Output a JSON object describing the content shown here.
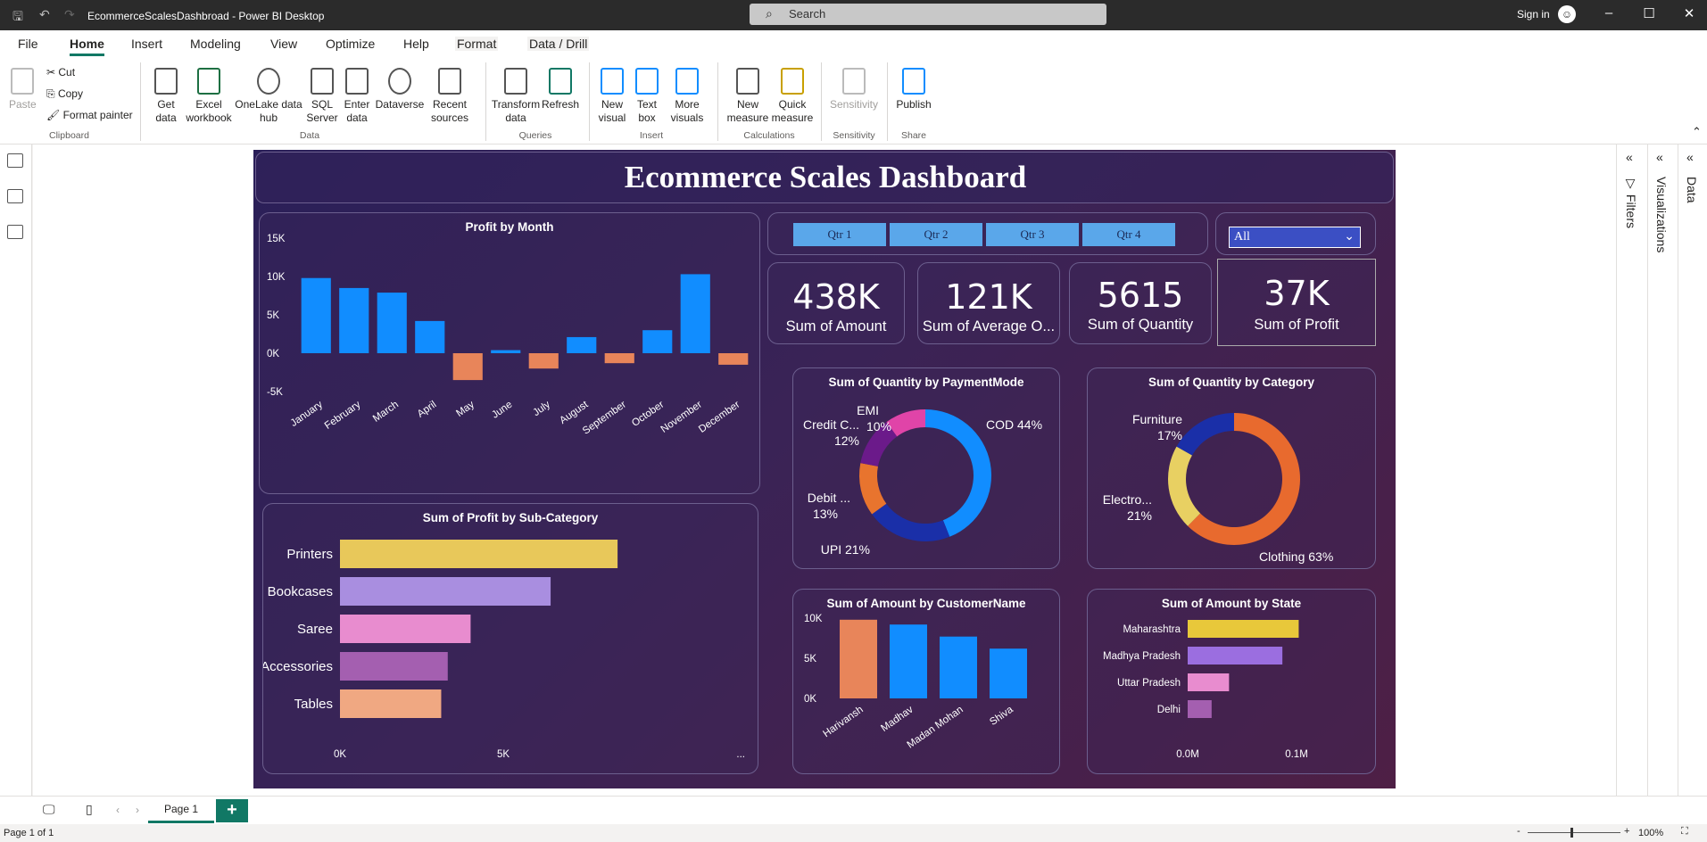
{
  "app": {
    "title": "EcommerceScalesDashbroad - Power BI Desktop",
    "search_placeholder": "Search",
    "signin": "Sign in"
  },
  "menu": [
    "File",
    "Home",
    "Insert",
    "Modeling",
    "View",
    "Optimize",
    "Help",
    "Format",
    "Data / Drill"
  ],
  "ribbon": {
    "clipboard": {
      "paste": "Paste",
      "cut": "Cut",
      "copy": "Copy",
      "format_painter": "Format painter",
      "group": "Clipboard"
    },
    "data": {
      "items": [
        "Get data",
        "Excel workbook",
        "OneLake data hub",
        "SQL Server",
        "Enter data",
        "Dataverse",
        "Recent sources"
      ],
      "group": "Data"
    },
    "queries": {
      "items": [
        "Transform data",
        "Refresh"
      ],
      "group": "Queries"
    },
    "insert": {
      "items": [
        "New visual",
        "Text box",
        "More visuals"
      ],
      "group": "Insert"
    },
    "calculations": {
      "items": [
        "New measure",
        "Quick measure"
      ],
      "group": "Calculations"
    },
    "sensitivity": {
      "items": [
        "Sensitivity"
      ],
      "group": "Sensitivity"
    },
    "share": {
      "items": [
        "Publish"
      ],
      "group": "Share"
    }
  },
  "dashboard": {
    "title": "Ecommerce Scales Dashboard",
    "quarters": [
      "Qtr 1",
      "Qtr 2",
      "Qtr 3",
      "Qtr 4"
    ],
    "slicer_value": "All",
    "cards": [
      {
        "value": "438K",
        "label": "Sum of Amount"
      },
      {
        "value": "121K",
        "label": "Sum of Average O..."
      },
      {
        "value": "5615",
        "label": "Sum of Quantity"
      },
      {
        "value": "37K",
        "label": "Sum of Profit"
      }
    ]
  },
  "chart_data": [
    {
      "type": "bar",
      "title": "Profit by Month",
      "categories": [
        "January",
        "February",
        "March",
        "April",
        "May",
        "June",
        "July",
        "August",
        "September",
        "October",
        "November",
        "December"
      ],
      "values": [
        9800,
        8500,
        7900,
        4200,
        -3500,
        400,
        -2000,
        2100,
        -1300,
        3000,
        10300,
        -1500
      ],
      "ylim": [
        -5000,
        15000
      ],
      "yticks": [
        "-5K",
        "0K",
        "5K",
        "10K",
        "15K"
      ],
      "colors": {
        "positive": "#118dff",
        "negative": "#e8855a"
      }
    },
    {
      "type": "bar",
      "orientation": "horizontal",
      "title": "Sum of Profit by Sub-Category",
      "categories": [
        "Printers",
        "Bookcases",
        "Saree",
        "Accessories",
        "Tables"
      ],
      "values": [
        8500,
        6450,
        4000,
        3300,
        3100
      ],
      "xticks": [
        "0K",
        "5K",
        "..."
      ],
      "colors": [
        "#e8c85a",
        "#a98ee0",
        "#e88ccf",
        "#a45fb0",
        "#f0a882"
      ]
    },
    {
      "type": "pie",
      "title": "Sum of Quantity by PaymentMode",
      "slices": [
        {
          "label": "COD",
          "value": 44,
          "color": "#118dff"
        },
        {
          "label": "UPI",
          "value": 21,
          "color": "#1a2fa8"
        },
        {
          "label": "Debit ...",
          "value": 13,
          "color": "#e8742e"
        },
        {
          "label": "Credit C...",
          "value": 12,
          "color": "#6b1a8a"
        },
        {
          "label": "EMI",
          "value": 10,
          "color": "#e044a8"
        }
      ]
    },
    {
      "type": "pie",
      "title": "Sum of Quantity by Category",
      "slices": [
        {
          "label": "Clothing",
          "value": 63,
          "color": "#e86a2e"
        },
        {
          "label": "Electro...",
          "value": 21,
          "color": "#e8d062"
        },
        {
          "label": "Furniture",
          "value": 17,
          "color": "#1a2fa8"
        }
      ]
    },
    {
      "type": "bar",
      "title": "Sum of Amount by CustomerName",
      "categories": [
        "Harivansh",
        "Madhav",
        "Madan Mohan",
        "Shiva"
      ],
      "values": [
        9800,
        9200,
        7700,
        6200
      ],
      "yticks": [
        "0K",
        "5K",
        "10K"
      ],
      "colors": [
        "#e8855a",
        "#118dff",
        "#118dff",
        "#118dff"
      ]
    },
    {
      "type": "bar",
      "orientation": "horizontal",
      "title": "Sum of Amount by State",
      "categories": [
        "Maharashtra",
        "Madhya Pradesh",
        "Uttar Pradesh",
        "Delhi"
      ],
      "values": [
        0.102,
        0.087,
        0.038,
        0.022
      ],
      "xticks": [
        "0.0M",
        "0.1M"
      ],
      "colors": [
        "#e8c83a",
        "#9b6ee0",
        "#e88ccf",
        "#a45fb0"
      ]
    }
  ],
  "panes": {
    "filters": "Filters",
    "visualizations": "Visualizations",
    "data": "Data"
  },
  "pages": {
    "tab": "Page 1",
    "status": "Page 1 of 1",
    "zoom": "100%"
  }
}
